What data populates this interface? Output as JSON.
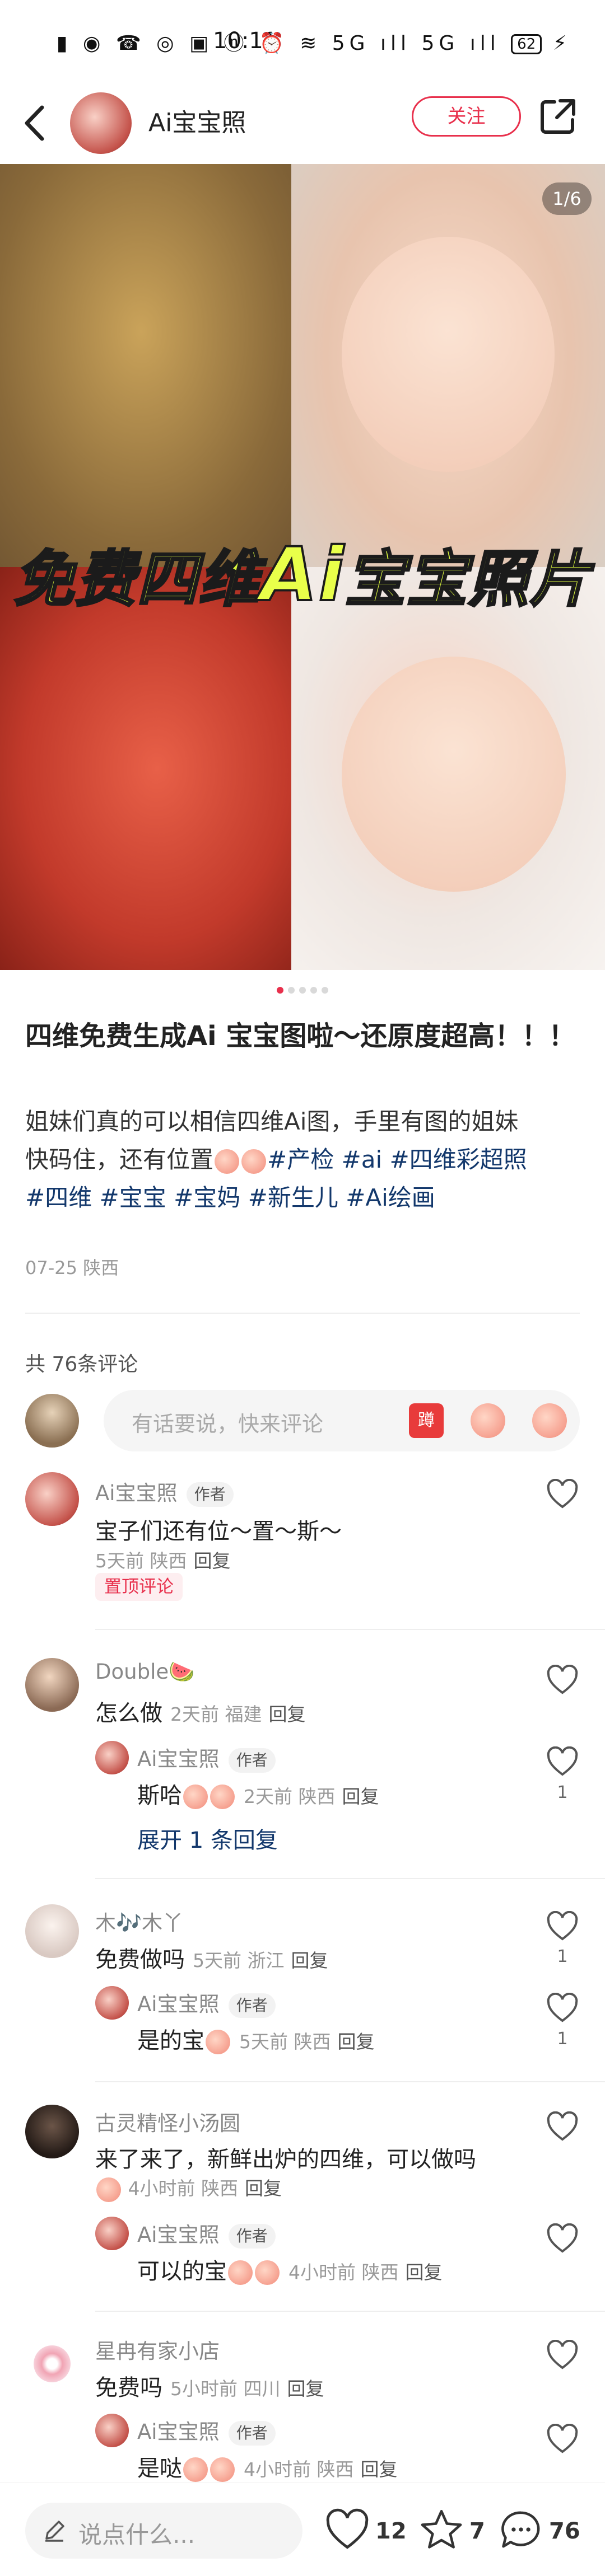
{
  "status": {
    "time": "10:11",
    "icons": "▮ ◉ ☎  ◎ ▣ ⓝ ⏰ ≋ 5G ıll 5G ıll",
    "battery": "62",
    "charge": "⚡"
  },
  "header": {
    "author": "Ai宝宝照",
    "follow": "关注"
  },
  "hero": {
    "overlay_prefix": "免费四维",
    "overlay_ai": "Ai",
    "overlay_suffix": "宝宝照片",
    "pager": "1/6"
  },
  "post": {
    "title": "四维免费生成Ai 宝宝图啦～还原度超高！！！",
    "body_line1": "姐妹们真的可以相信四维Ai图，手里有图的姐妹",
    "body_line2_a": "快码住，还有位置",
    "tags_line2": "#产检 #ai #四维彩超照",
    "tags_line3": "#四维 #宝宝 #宝妈 #新生儿 #Ai绘画",
    "meta": "07-25 陕西"
  },
  "comments_section": {
    "count": "共 76条评论",
    "input_placeholder": "有话要说，快来评论",
    "sticker": "蹲"
  },
  "comments": [
    {
      "name": "Ai宝宝照",
      "badge": "作者",
      "text": "宝子们还有位～置～斯～",
      "time": "5天前",
      "loc": "陕西",
      "reply": "回复",
      "pin": "置顶评论"
    },
    {
      "name": "Double🍉",
      "text": "怎么做",
      "time": "2天前",
      "loc": "福建",
      "reply": "回复",
      "sub": {
        "name": "Ai宝宝照",
        "badge": "作者",
        "text": "斯哈",
        "time": "2天前",
        "loc": "陕西",
        "reply": "回复",
        "likes": "1"
      },
      "expand": "展开 1 条回复"
    },
    {
      "name": "木🎶木丫",
      "text": "免费做吗",
      "time": "5天前",
      "loc": "浙江",
      "reply": "回复",
      "likes": "1",
      "sub": {
        "name": "Ai宝宝照",
        "badge": "作者",
        "text": "是的宝",
        "time": "5天前",
        "loc": "陕西",
        "reply": "回复",
        "likes": "1"
      }
    },
    {
      "name": "古灵精怪小汤圆",
      "text": "来了来了，新鲜出炉的四维，可以做吗",
      "time": "4小时前",
      "loc": "陕西",
      "reply": "回复",
      "sub": {
        "name": "Ai宝宝照",
        "badge": "作者",
        "text": "可以的宝",
        "time": "4小时前",
        "loc": "陕西",
        "reply": "回复"
      }
    },
    {
      "name": "星冉有家小店",
      "text": "免费吗",
      "time": "5小时前",
      "loc": "四川",
      "reply": "回复",
      "sub": {
        "name": "Ai宝宝照",
        "badge": "作者",
        "text": "是哒",
        "time": "4小时前",
        "loc": "陕西",
        "reply": "回复"
      }
    }
  ],
  "bottom": {
    "say": "说点什么...",
    "likes": "12",
    "collects": "7",
    "comments": "76"
  },
  "colors": {
    "accent": "#e8304c",
    "tag": "#13386c"
  }
}
